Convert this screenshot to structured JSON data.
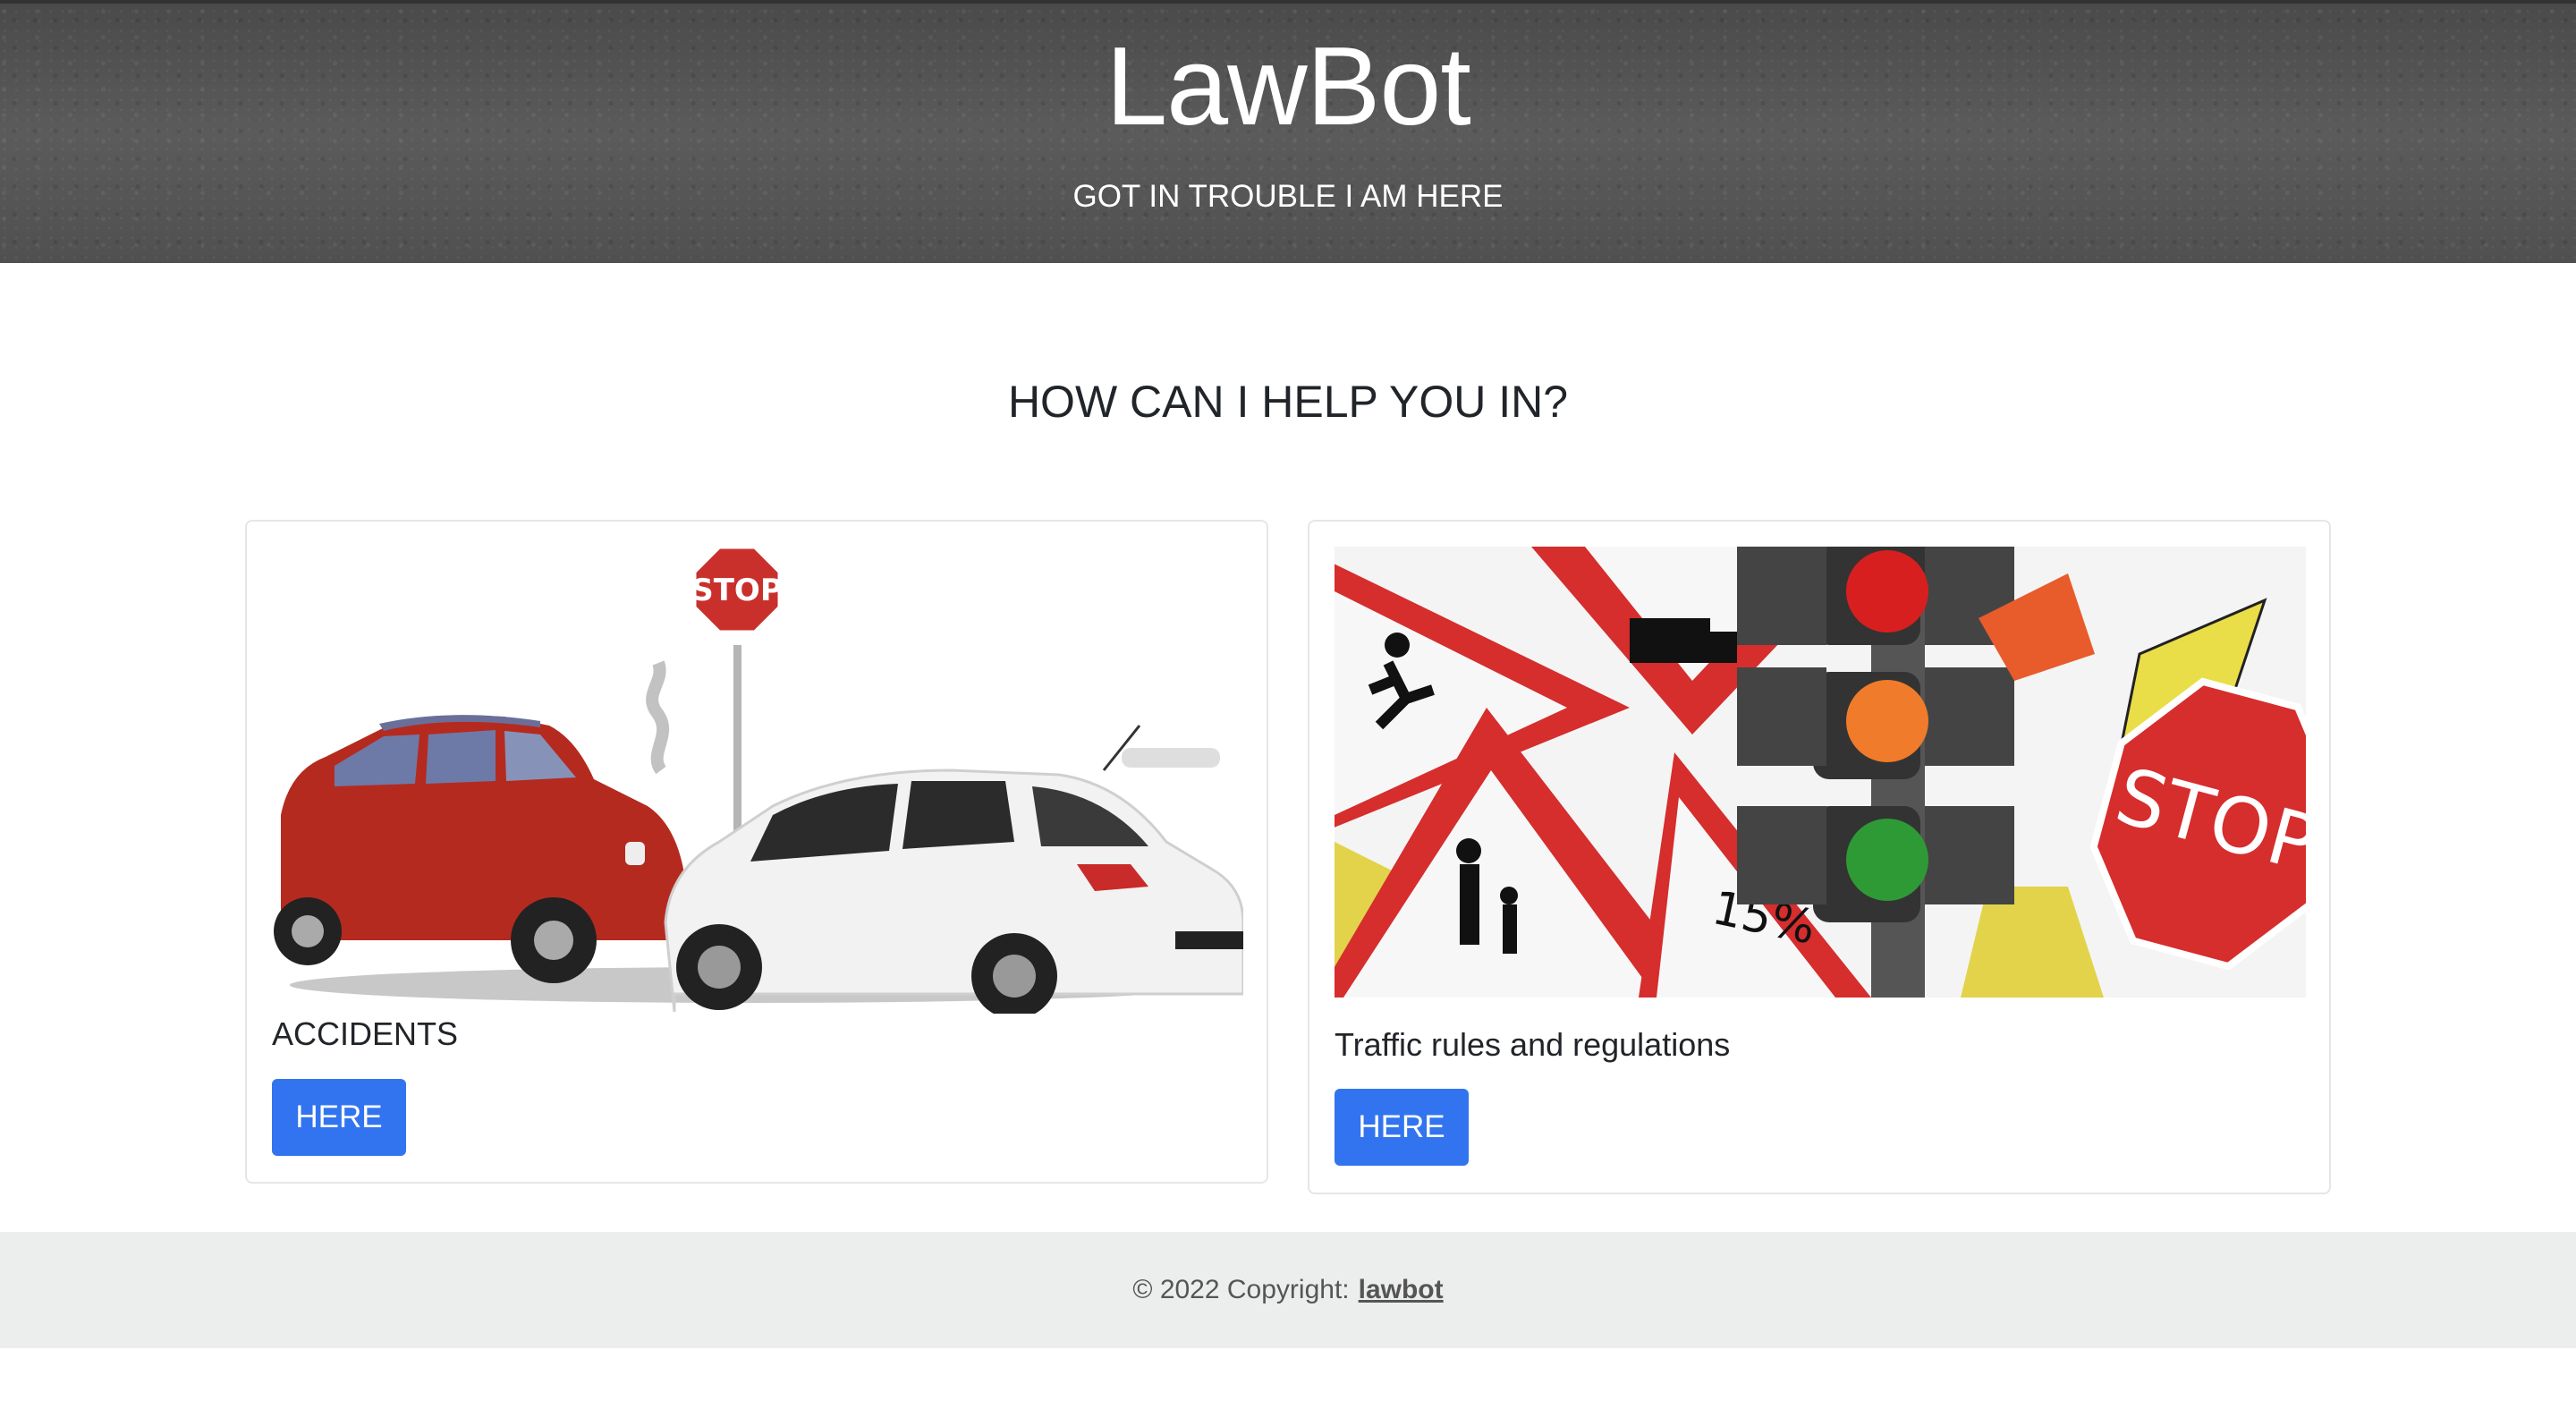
{
  "hero": {
    "title": "LawBot",
    "subtitle": "GOT IN TROUBLE I AM HERE"
  },
  "main": {
    "heading": "HOW CAN I HELP YOU IN?",
    "cards": [
      {
        "label": "ACCIDENTS",
        "button": "HERE",
        "image": "car-accident-illustration"
      },
      {
        "label": "Traffic rules and regulations",
        "button": "HERE",
        "image": "traffic-signs-illustration"
      }
    ]
  },
  "footer": {
    "text": "© 2022 Copyright:",
    "link": "lawbot"
  },
  "colors": {
    "button": "#3274f0",
    "hero_bg": "#555555",
    "footer_bg": "#eceded"
  }
}
